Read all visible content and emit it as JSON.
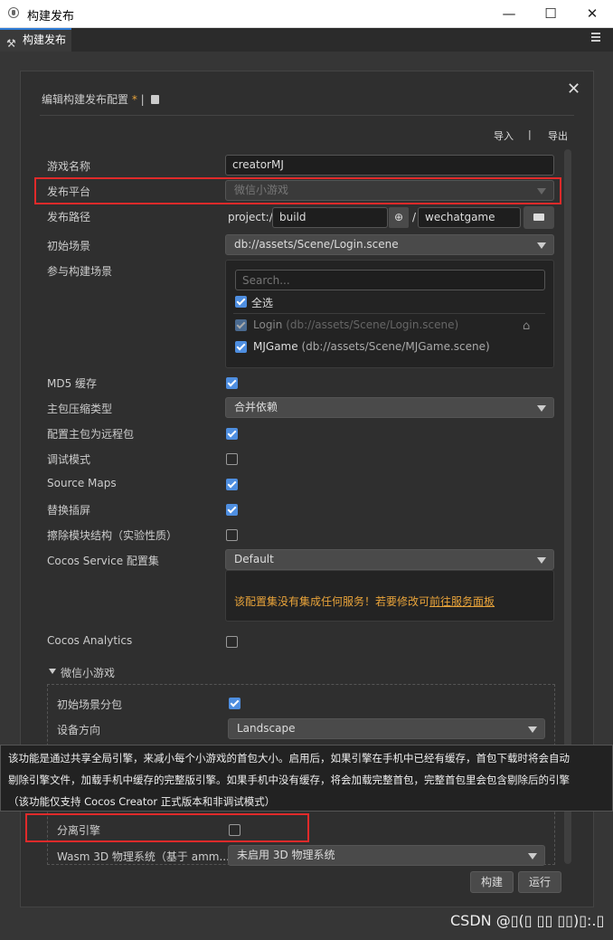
{
  "window": {
    "title": "构建发布",
    "minimize": "—",
    "maximize": "☐",
    "close": "✕"
  },
  "tab": {
    "label": "构建发布"
  },
  "dialog": {
    "title_prefix": "编辑构建发布配置",
    "title_star": " * ",
    "title_sep": "|",
    "import_label": "导入",
    "divider": "|",
    "export_label": "导出"
  },
  "fields": {
    "game_name_label": "游戏名称",
    "game_name_value": "creatorMJ",
    "platform_label": "发布平台",
    "platform_value": "微信小游戏",
    "path_label": "发布路径",
    "path_prefix": "project://",
    "path_value": "build",
    "path_slash": "/",
    "path_folder": "wechatgame",
    "start_scene_label": "初始场景",
    "start_scene_value": "db://assets/Scene/Login.scene",
    "scenes_label": "参与构建场景",
    "search_placeholder": "Search...",
    "select_all": "全选",
    "scene1_name": "Login",
    "scene1_path": " (db://assets/Scene/Login.scene)",
    "scene2_name": "MJGame",
    "scene2_path": " (db://assets/Scene/MJGame.scene)",
    "md5_label": "MD5 缓存",
    "compress_label": "主包压缩类型",
    "compress_value": "合并依赖",
    "remote_label": "配置主包为远程包",
    "debug_label": "调试模式",
    "sourcemaps_label": "Source Maps",
    "splash_label": "替换插屏",
    "erase_label": "擦除模块结构（实验性质）",
    "service_label": "Cocos Service 配置集",
    "service_value": "Default",
    "service_warning": "该配置集没有集成任何服务！若要修改可",
    "service_link": "前往服务面板",
    "analytics_label": "Cocos Analytics",
    "wechat_section": "微信小游戏",
    "subpackage_label": "初始场景分包",
    "orientation_label": "设备方向",
    "orientation_value": "Landscape",
    "separate_engine_label": "分离引擎",
    "wasm_label": "Wasm 3D 物理系统（基于 amm...",
    "wasm_value": "未启用 3D 物理系统"
  },
  "tooltip": {
    "line1": "该功能是通过共享全局引擎，来减小每个小游戏的首包大小。启用后，如果引擎在手机中已经有缓存，首包下载时将会自动",
    "line2": "剔除引擎文件，加载手机中缓存的完整版引擎。如果手机中没有缓存，将会加载完整首包，完整首包里会包含剔除后的引擎",
    "line3": "（该功能仅支持 Cocos Creator 正式版本和非调试模式）"
  },
  "buttons": {
    "build": "构建",
    "run": "运行"
  },
  "watermark": "CSDN @▯(▯ ▯▯ ▯▯)▯:.▯",
  "checkbox_states": {
    "select_all": true,
    "scene1": true,
    "scene2": true,
    "md5": true,
    "remote": true,
    "debug": false,
    "sourcemaps": true,
    "splash": true,
    "erase": false,
    "analytics": false,
    "subpackage": true,
    "separate_engine": false
  },
  "colors": {
    "accent": "#4e8ee0",
    "warning": "#e8a33a",
    "highlight": "#e02a2a"
  }
}
